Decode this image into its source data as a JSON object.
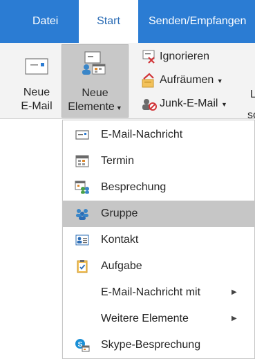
{
  "tabs": {
    "datei": "Datei",
    "start": "Start",
    "senden": "Senden/Empfangen"
  },
  "ribbon": {
    "new_email": {
      "line1": "Neue",
      "line2": "E-Mail"
    },
    "new_items": {
      "line1": "Neue",
      "line2": "Elemente"
    },
    "ignore": "Ignorieren",
    "cleanup": "Aufräumen",
    "junk": "Junk-E-Mail",
    "clipped_letter": "L",
    "clipped_group": "sc"
  },
  "menu": {
    "items": [
      {
        "label": "E-Mail-Nachricht",
        "icon": "envelope-icon"
      },
      {
        "label": "Termin",
        "icon": "calendar-icon"
      },
      {
        "label": "Besprechung",
        "icon": "meeting-icon"
      },
      {
        "label": "Gruppe",
        "icon": "group-icon",
        "highlighted": true
      },
      {
        "label": "Kontakt",
        "icon": "contact-card-icon"
      },
      {
        "label": "Aufgabe",
        "icon": "task-clipboard-icon"
      },
      {
        "label": "E-Mail-Nachricht mit",
        "submenu": true
      },
      {
        "label": "Weitere Elemente",
        "submenu": true
      },
      {
        "label": "Skype-Besprechung",
        "icon": "skype-meeting-icon"
      }
    ]
  },
  "colors": {
    "accent": "#2b7cd3",
    "highlight": "#c6c6c6",
    "ribbon_bg": "#f3f3f3"
  }
}
